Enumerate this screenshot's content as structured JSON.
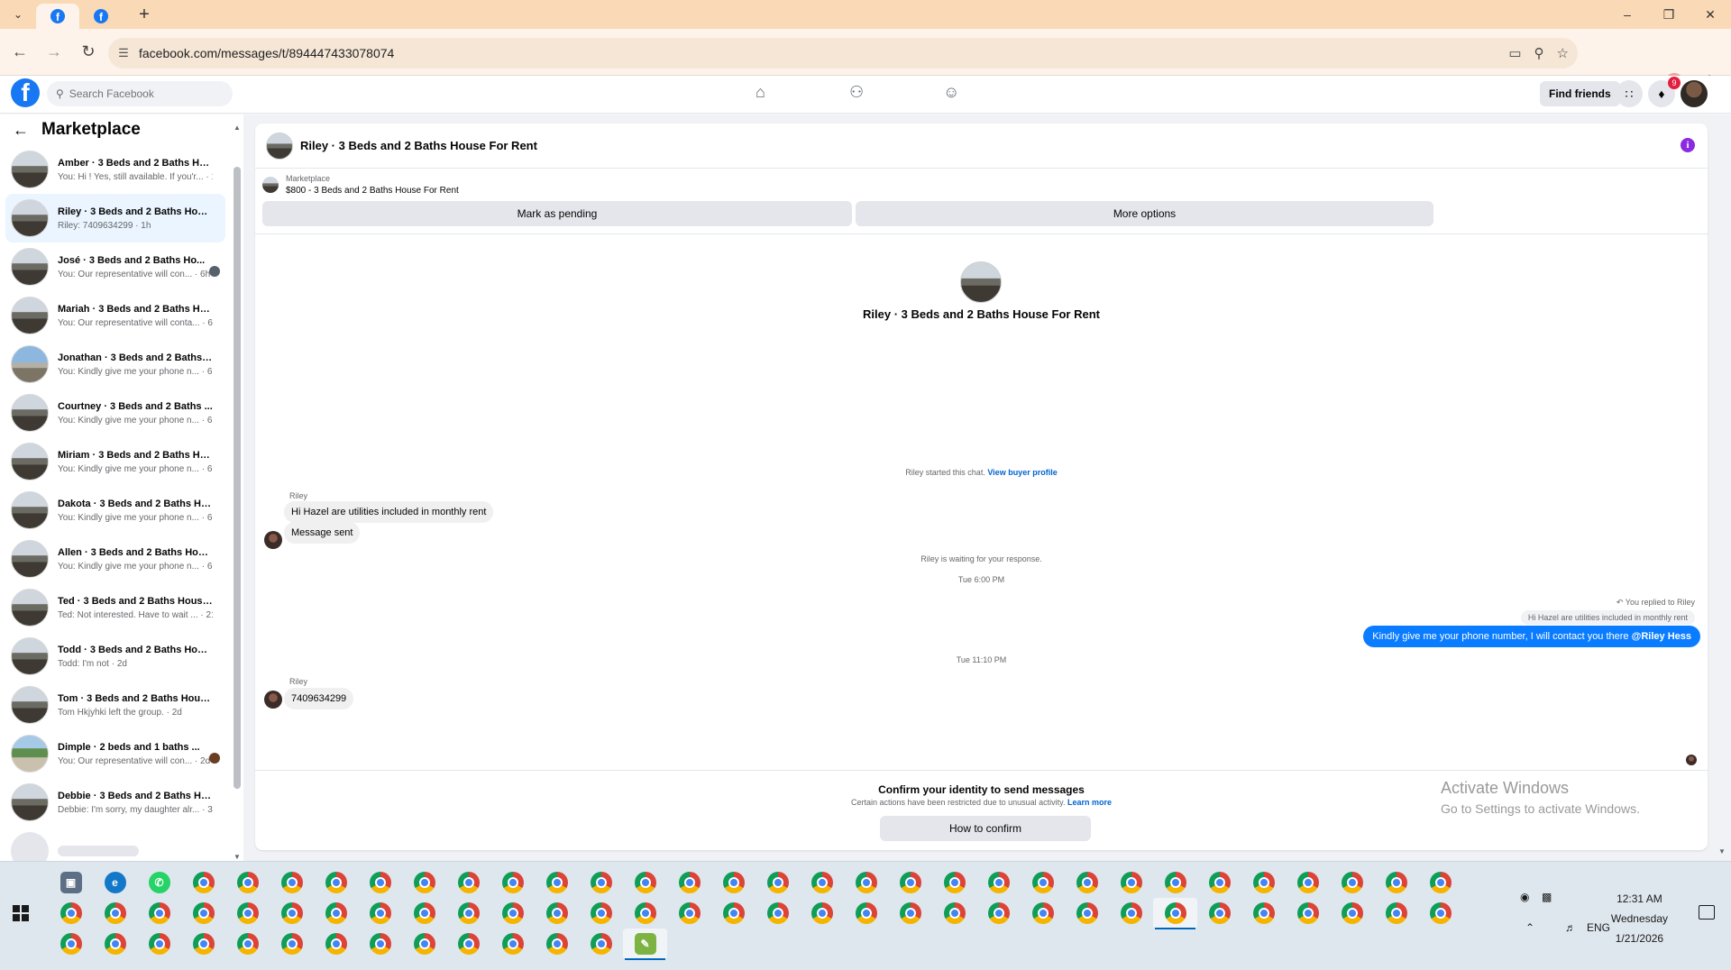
{
  "browser": {
    "url": "facebook.com/messages/t/894447433078074"
  },
  "header": {
    "search_placeholder": "Search Facebook",
    "find_friends": "Find friends",
    "notifications_count": "9"
  },
  "sidebar": {
    "title": "Marketplace",
    "conversations": [
      {
        "name": "Amber · 3 Beds and 2 Baths Ho...",
        "preview": "You: Hi ! Yes, still available. If you'r... · 1m"
      },
      {
        "name": "Riley · 3 Beds and 2 Baths Hous...",
        "preview": "Riley: 7409634299 · 1h"
      },
      {
        "name": "José · 3 Beds and 2 Baths Ho...",
        "preview": "You: Our representative will con... · 6h"
      },
      {
        "name": "Mariah · 3 Beds and 2 Baths Ho...",
        "preview": "You: Our representative will conta... · 6h"
      },
      {
        "name": "Jonathan · 3 Beds and 2 Baths ...",
        "preview": "You: Kindly give me your phone n... · 6h"
      },
      {
        "name": "Courtney · 3 Beds and 2 Baths ...",
        "preview": "You: Kindly give me your phone n... · 6h"
      },
      {
        "name": "Miriam · 3 Beds and 2 Baths Ho...",
        "preview": "You: Kindly give me your phone n... · 6h"
      },
      {
        "name": "Dakota · 3 Beds and 2 Baths Ho...",
        "preview": "You: Kindly give me your phone n... · 6h"
      },
      {
        "name": "Allen · 3 Beds and 2 Baths Hous...",
        "preview": "You: Kindly give me your phone n... · 6h"
      },
      {
        "name": "Ted · 3 Beds and 2 Baths House...",
        "preview": "Ted: Not interested. Have to wait ... · 21h"
      },
      {
        "name": "Todd · 3 Beds and 2 Baths Hous...",
        "preview": "Todd: I'm not · 2d"
      },
      {
        "name": "Tom · 3 Beds and 2 Baths Hous...",
        "preview": "Tom Hkjyhki left the group. · 2d"
      },
      {
        "name": "Dimple · 2 beds and 1 baths ...",
        "preview": "You: Our representative will con... · 2d"
      },
      {
        "name": "Debbie · 3 Beds and 2 Baths Ho...",
        "preview": "Debbie: I'm sorry, my daughter alr... · 3d"
      }
    ]
  },
  "chat": {
    "title": "Riley · 3 Beds and 2 Baths House For Rent",
    "listing_category": "Marketplace",
    "listing_price_title": "$800 - 3 Beds and 2 Baths House For Rent",
    "mark_pending": "Mark as pending",
    "more_options": "More options",
    "intro_title": "Riley · 3 Beds and 2 Baths House For Rent",
    "started_text": "Riley started this chat.",
    "view_profile": "View buyer profile",
    "sender1": "Riley",
    "msg1": "Hi Hazel are utilities included in monthly rent",
    "msg2": "Message sent",
    "waiting": "Riley is waiting for your response.",
    "time1": "Tue 6:00 PM",
    "replied_label": "You replied to Riley",
    "quoted": "Hi Hazel are utilities included in monthly rent",
    "out_msg": "Kindly give me your phone number, I will contact you there",
    "out_mention": "@Riley Hess",
    "time2": "Tue 11:10 PM",
    "sender2": "Riley",
    "msg3": "7409634299",
    "footer_title": "Confirm your identity to send messages",
    "footer_desc": "Certain actions have been restricted due to unusual activity.",
    "learn_more": "Learn more",
    "how_confirm": "How to confirm"
  },
  "watermark": {
    "line1": "Activate Windows",
    "line2": "Go to Settings to activate Windows."
  },
  "taskbar": {
    "language": "ENG",
    "time": "12:31 AM",
    "day": "Wednesday",
    "date": "1/21/2026"
  }
}
